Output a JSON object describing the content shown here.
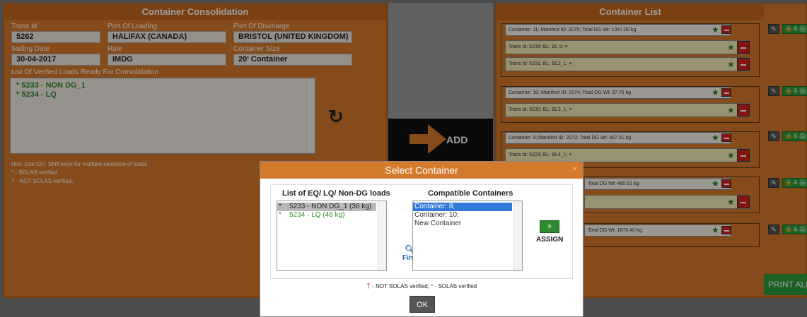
{
  "left": {
    "title": "Container Consolidation",
    "trans_id_label": "Trans Id",
    "trans_id": "5262",
    "port_loading_label": "Port Of Loading",
    "port_loading": "HALIFAX (CANADA)",
    "port_discharge_label": "Port Of Discharge",
    "port_discharge": "BRISTOL (UNITED KINGDOM)",
    "sailing_date_label": "Sailing Date",
    "sailing_date": "30-04-2017",
    "rule_label": "Rule",
    "rule": "IMDG",
    "container_size_label": "Container Size",
    "container_size": "20' Container",
    "list_label": "List Of Verified Loads Ready For Consolidation",
    "loads": [
      "*  5233 - NON DG_1",
      "*  5234 - LQ"
    ],
    "hint": "Hint: Use Ctrl, Shift keys for multiple selection of loads",
    "solas_note": "* - SOLAS verified.",
    "not_solas_note": "† - NOT SOLAS verified."
  },
  "middle": {
    "add_label": "ADD"
  },
  "right": {
    "title": "Container List",
    "print_all": "PRINT ALL",
    "lock_label": "🔒 & 🖨",
    "groups": [
      {
        "container": "Container: 11; Manifest ID: 2075; Total DG Wt: 1047.00 kg",
        "loads": [
          "Trans Id: 5239; BL: BL 9; ≡",
          "Trans Id: 5231; BL: BL2_1; ≡"
        ]
      },
      {
        "container": "Container: 10; Manifest ID: 2074; Total DG Wt: 37.76 kg",
        "loads": [
          "Trans Id: 5230; BL: BL3_1; ≡"
        ]
      },
      {
        "container": "Container: 9; Manifest ID: 2073; Total DG Wt: 467.51 kg",
        "loads": [
          "Trans Id: 5229; BL: BL4_1; ≡"
        ]
      },
      {
        "container": "Total DG Wt: 465.51 kg",
        "loads": [
          ""
        ]
      },
      {
        "container": "Total DG Wt: 1876.40 kg",
        "loads": []
      }
    ]
  },
  "modal": {
    "title": "Select Container",
    "close": "×",
    "loads_title": "List of EQ/ LQ/ Non-DG loads",
    "loads": [
      {
        "star": "*",
        "text": "5233 - NON DG_1 (36 kg)"
      },
      {
        "star": "*",
        "text": "5234 - LQ (46 kg)"
      }
    ],
    "find_label": "Find",
    "containers_title": "Compatible Containers",
    "containers": [
      "Container: 8;",
      "Container: 10;",
      "New Container"
    ],
    "assign_label": "ASSIGN",
    "assign_icon": "»",
    "legend_dagger": "†",
    "legend_text": " - NOT SOLAS verified; ",
    "legend_star": "*",
    "legend_text2": " - SOLAS verified",
    "ok_label": "OK"
  },
  "colors": {
    "accent": "#d7792a",
    "green": "#2e9b3a",
    "red": "#d9231c"
  }
}
